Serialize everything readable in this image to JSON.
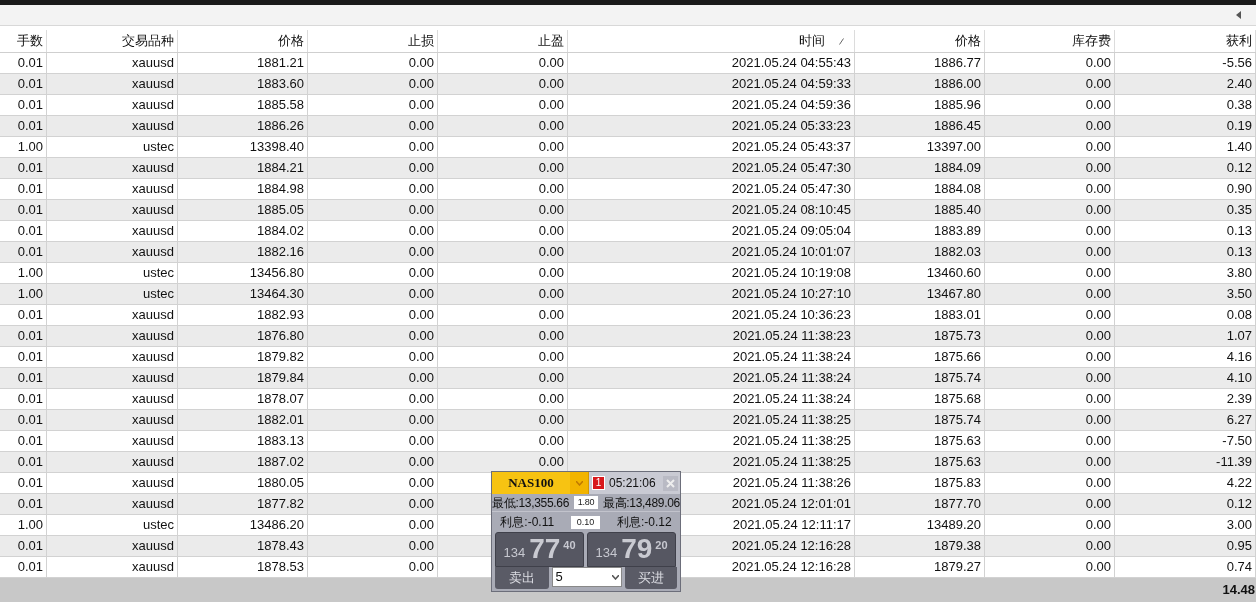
{
  "columns": [
    {
      "label": "手数",
      "sorted": false
    },
    {
      "label": "交易品种",
      "sorted": false
    },
    {
      "label": "价格",
      "sorted": false
    },
    {
      "label": "止损",
      "sorted": false
    },
    {
      "label": "止盈",
      "sorted": false
    },
    {
      "label": "时间",
      "sorted": true
    },
    {
      "label": "价格",
      "sorted": false
    },
    {
      "label": "库存费",
      "sorted": false
    },
    {
      "label": "获利",
      "sorted": false
    }
  ],
  "rows": [
    {
      "lots": "0.01",
      "symbol": "xauusd",
      "open_price": "1881.21",
      "stop_loss": "0.00",
      "take_profit": "0.00",
      "time": "2021.05.24 04:55:43",
      "price": "1886.77",
      "swap": "0.00",
      "profit": "-5.56"
    },
    {
      "lots": "0.01",
      "symbol": "xauusd",
      "open_price": "1883.60",
      "stop_loss": "0.00",
      "take_profit": "0.00",
      "time": "2021.05.24 04:59:33",
      "price": "1886.00",
      "swap": "0.00",
      "profit": "2.40"
    },
    {
      "lots": "0.01",
      "symbol": "xauusd",
      "open_price": "1885.58",
      "stop_loss": "0.00",
      "take_profit": "0.00",
      "time": "2021.05.24 04:59:36",
      "price": "1885.96",
      "swap": "0.00",
      "profit": "0.38"
    },
    {
      "lots": "0.01",
      "symbol": "xauusd",
      "open_price": "1886.26",
      "stop_loss": "0.00",
      "take_profit": "0.00",
      "time": "2021.05.24 05:33:23",
      "price": "1886.45",
      "swap": "0.00",
      "profit": "0.19"
    },
    {
      "lots": "1.00",
      "symbol": "ustec",
      "open_price": "13398.40",
      "stop_loss": "0.00",
      "take_profit": "0.00",
      "time": "2021.05.24 05:43:37",
      "price": "13397.00",
      "swap": "0.00",
      "profit": "1.40"
    },
    {
      "lots": "0.01",
      "symbol": "xauusd",
      "open_price": "1884.21",
      "stop_loss": "0.00",
      "take_profit": "0.00",
      "time": "2021.05.24 05:47:30",
      "price": "1884.09",
      "swap": "0.00",
      "profit": "0.12"
    },
    {
      "lots": "0.01",
      "symbol": "xauusd",
      "open_price": "1884.98",
      "stop_loss": "0.00",
      "take_profit": "0.00",
      "time": "2021.05.24 05:47:30",
      "price": "1884.08",
      "swap": "0.00",
      "profit": "0.90"
    },
    {
      "lots": "0.01",
      "symbol": "xauusd",
      "open_price": "1885.05",
      "stop_loss": "0.00",
      "take_profit": "0.00",
      "time": "2021.05.24 08:10:45",
      "price": "1885.40",
      "swap": "0.00",
      "profit": "0.35"
    },
    {
      "lots": "0.01",
      "symbol": "xauusd",
      "open_price": "1884.02",
      "stop_loss": "0.00",
      "take_profit": "0.00",
      "time": "2021.05.24 09:05:04",
      "price": "1883.89",
      "swap": "0.00",
      "profit": "0.13"
    },
    {
      "lots": "0.01",
      "symbol": "xauusd",
      "open_price": "1882.16",
      "stop_loss": "0.00",
      "take_profit": "0.00",
      "time": "2021.05.24 10:01:07",
      "price": "1882.03",
      "swap": "0.00",
      "profit": "0.13"
    },
    {
      "lots": "1.00",
      "symbol": "ustec",
      "open_price": "13456.80",
      "stop_loss": "0.00",
      "take_profit": "0.00",
      "time": "2021.05.24 10:19:08",
      "price": "13460.60",
      "swap": "0.00",
      "profit": "3.80"
    },
    {
      "lots": "1.00",
      "symbol": "ustec",
      "open_price": "13464.30",
      "stop_loss": "0.00",
      "take_profit": "0.00",
      "time": "2021.05.24 10:27:10",
      "price": "13467.80",
      "swap": "0.00",
      "profit": "3.50"
    },
    {
      "lots": "0.01",
      "symbol": "xauusd",
      "open_price": "1882.93",
      "stop_loss": "0.00",
      "take_profit": "0.00",
      "time": "2021.05.24 10:36:23",
      "price": "1883.01",
      "swap": "0.00",
      "profit": "0.08"
    },
    {
      "lots": "0.01",
      "symbol": "xauusd",
      "open_price": "1876.80",
      "stop_loss": "0.00",
      "take_profit": "0.00",
      "time": "2021.05.24 11:38:23",
      "price": "1875.73",
      "swap": "0.00",
      "profit": "1.07"
    },
    {
      "lots": "0.01",
      "symbol": "xauusd",
      "open_price": "1879.82",
      "stop_loss": "0.00",
      "take_profit": "0.00",
      "time": "2021.05.24 11:38:24",
      "price": "1875.66",
      "swap": "0.00",
      "profit": "4.16"
    },
    {
      "lots": "0.01",
      "symbol": "xauusd",
      "open_price": "1879.84",
      "stop_loss": "0.00",
      "take_profit": "0.00",
      "time": "2021.05.24 11:38:24",
      "price": "1875.74",
      "swap": "0.00",
      "profit": "4.10"
    },
    {
      "lots": "0.01",
      "symbol": "xauusd",
      "open_price": "1878.07",
      "stop_loss": "0.00",
      "take_profit": "0.00",
      "time": "2021.05.24 11:38:24",
      "price": "1875.68",
      "swap": "0.00",
      "profit": "2.39"
    },
    {
      "lots": "0.01",
      "symbol": "xauusd",
      "open_price": "1882.01",
      "stop_loss": "0.00",
      "take_profit": "0.00",
      "time": "2021.05.24 11:38:25",
      "price": "1875.74",
      "swap": "0.00",
      "profit": "6.27"
    },
    {
      "lots": "0.01",
      "symbol": "xauusd",
      "open_price": "1883.13",
      "stop_loss": "0.00",
      "take_profit": "0.00",
      "time": "2021.05.24 11:38:25",
      "price": "1875.63",
      "swap": "0.00",
      "profit": "-7.50"
    },
    {
      "lots": "0.01",
      "symbol": "xauusd",
      "open_price": "1887.02",
      "stop_loss": "0.00",
      "take_profit": "0.00",
      "time": "2021.05.24 11:38:25",
      "price": "1875.63",
      "swap": "0.00",
      "profit": "-11.39"
    },
    {
      "lots": "0.01",
      "symbol": "xauusd",
      "open_price": "1880.05",
      "stop_loss": "0.00",
      "time": "2021.05.24 11:38:26",
      "price": "1875.83",
      "swap": "0.00",
      "profit": "4.22"
    },
    {
      "lots": "0.01",
      "symbol": "xauusd",
      "open_price": "1877.82",
      "stop_loss": "0.00",
      "time": "2021.05.24 12:01:01",
      "price": "1877.70",
      "swap": "0.00",
      "profit": "0.12"
    },
    {
      "lots": "1.00",
      "symbol": "ustec",
      "open_price": "13486.20",
      "stop_loss": "0.00",
      "time": "2021.05.24 12:11:17",
      "price": "13489.20",
      "swap": "0.00",
      "profit": "3.00"
    },
    {
      "lots": "0.01",
      "symbol": "xauusd",
      "open_price": "1878.43",
      "stop_loss": "0.00",
      "time": "2021.05.24 12:16:28",
      "price": "1879.38",
      "swap": "0.00",
      "profit": "0.95"
    },
    {
      "lots": "0.01",
      "symbol": "xauusd",
      "open_price": "1878.53",
      "stop_loss": "0.00",
      "time": "2021.05.24 12:16:28",
      "price": "1879.27",
      "swap": "0.00",
      "profit": "0.74"
    }
  ],
  "footer": {
    "total": "14.48"
  },
  "trade_panel": {
    "symbol": "NAS100",
    "alert_count": "1",
    "time": "05:21:06",
    "low": "最低:13,355.66",
    "spread": "1.80",
    "high": "最高:13,489.06",
    "swap_sell": "利息:-0.11",
    "swap_step": "0.10",
    "swap_buy": "利息:-0.12",
    "sell": {
      "prefix": "134",
      "big": "77",
      "suffix": "40",
      "label": "卖出"
    },
    "buy": {
      "prefix": "134",
      "big": "79",
      "suffix": "20",
      "label": "买进"
    },
    "volume": "5"
  }
}
